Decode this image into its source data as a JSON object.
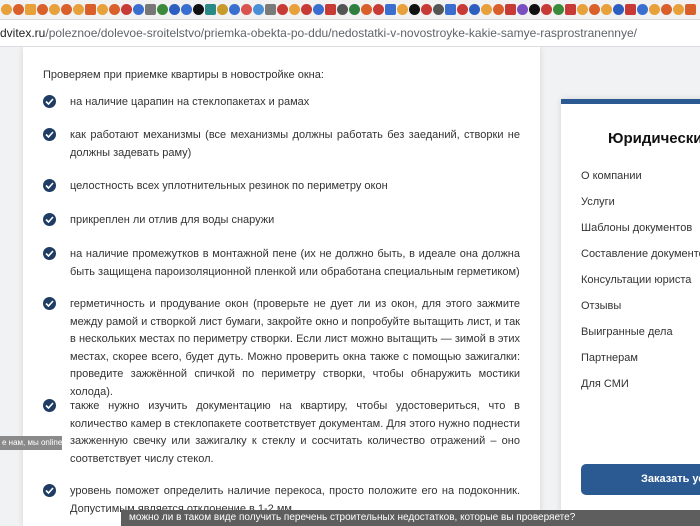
{
  "browser": {
    "url_host": "dvitex.ru",
    "url_path": "/poleznoe/dolevoe-sroitelstvo/priemka-obekta-po-ddu/nedostatki-v-novostroyke-kakie-samye-rasprostranennye/",
    "tab_icon_colors": [
      "#e8a13a",
      "#d95f2b",
      "#e8a13a",
      "#d95f2b",
      "#e8a13a",
      "#d95f2b",
      "#e8a13a",
      "#d95f2b",
      "#e8a13a",
      "#d95f2b",
      "#c73a35",
      "#3a6fd0",
      "#777777",
      "#3b8a3b",
      "#2c5fbf",
      "#3a6fd0",
      "#111111",
      "#2a8a88",
      "#c79a2b",
      "#3a6fd0",
      "#d9534f",
      "#4a90d9",
      "#7a7a7a",
      "#c73a35",
      "#e8a13a",
      "#c73a35",
      "#3a6fd0",
      "#c73a35",
      "#555555",
      "#2f7f3f",
      "#d95f2b",
      "#c73a35",
      "#3a6fd0",
      "#e8a13a",
      "#111111",
      "#c73a35",
      "#555555",
      "#3a6fd0",
      "#c73a35",
      "#2c5fbf",
      "#e8a13a",
      "#d95f2b",
      "#c73a35",
      "#7a4fc0",
      "#111111",
      "#c73a35",
      "#3b8a3b",
      "#c73a35",
      "#e8a13a",
      "#d95f2b",
      "#e8a13a",
      "#2c5fbf",
      "#c73a35",
      "#3a6fd0",
      "#e8a13a",
      "#d95f2b",
      "#e8a13a",
      "#d95f2b"
    ]
  },
  "article": {
    "intro": "Проверяем при приемке квартиры в новостройке окна:",
    "items": [
      "на наличие царапин на стеклопакетах и рамах",
      "как работают механизмы (все механизмы должны работать без заеданий, створки не должны задевать раму)",
      "целостность всех уплотнительных резинок по периметру окон",
      "прикреплен ли отлив для воды снаружи",
      "на наличие промежутков в монтажной пене (их не должно быть, в идеале она должна быть защищена пароизоляционной пленкой или обработана специальным герметиком)",
      "герметичность и продувание окон (проверьте не дует ли из окон, для этого зажмите между рамой и створкой лист бумаги, закройте окно и попробуйте вытащить лист, и так в нескольких местах по периметру створки. Если лист можно вытащить — зимой в этих местах, скорее всего, будет дуть. Можно проверить окна также с помощью зажигалки: проведите зажжённой спичкой по периметру створки, чтобы обнаружить мостики холода).",
      "также нужно изучить документацию на квартиру, чтобы удостовериться, что в количество камер в стеклопакете соответствует документам. Для этого нужно поднести зажженную свечку или зажигалку к стеклу и сосчитать количество отражений – оно соответствует числу стекол.",
      "уровень поможет определить наличие перекоса, просто положите его на подоконник. Допустимым является отклонение в 1-2 мм."
    ]
  },
  "sidebar": {
    "title": "Юридически",
    "items": [
      "О компании",
      "Услуги",
      "Шаблоны документов",
      "Составление документов",
      "Консультации юриста",
      "Отзывы",
      "Выигранные дела",
      "Партнерам",
      "Для СМИ"
    ],
    "button_label": "Заказать ус"
  },
  "chat": {
    "left_text": "е нам, мы online!",
    "bottom_text": "можно ли в таком виде получить перечень строительных недостатков, которые вы проверяете?"
  },
  "colors": {
    "accent": "#2b5a92",
    "check": "#1f3d64"
  }
}
